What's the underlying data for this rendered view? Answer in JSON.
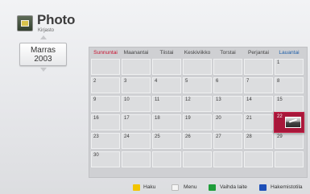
{
  "header": {
    "title": "Photo",
    "subtitle": "Kirjasto",
    "icon": "photo-icon"
  },
  "month_selector": {
    "month": "Marras",
    "year": "2003"
  },
  "calendar": {
    "day_headers": [
      "Sunnuntai",
      "Maanantai",
      "Tiistai",
      "Keskiviikko",
      "Torstai",
      "Perjantai",
      "Lauantai"
    ],
    "weeks": [
      [
        "",
        "",
        "",
        "",
        "",
        "",
        "1"
      ],
      [
        "2",
        "3",
        "4",
        "5",
        "6",
        "7",
        "8"
      ],
      [
        "9",
        "10",
        "11",
        "12",
        "13",
        "14",
        "15"
      ],
      [
        "16",
        "17",
        "18",
        "19",
        "20",
        "21",
        "22"
      ],
      [
        "23",
        "24",
        "25",
        "26",
        "27",
        "28",
        "29"
      ],
      [
        "30",
        "",
        "",
        "",
        "",
        "",
        ""
      ]
    ],
    "selected_day": "22",
    "colors": {
      "sunday": "#c8102e",
      "saturday": "#1f5fa8",
      "selected": "#a8173a"
    }
  },
  "footer": {
    "items": [
      {
        "color": "yellow",
        "key": "",
        "label": "Haku"
      },
      {
        "color": "white",
        "key": "",
        "label": "Menu"
      },
      {
        "color": "green",
        "key": "",
        "label": "Vaihda laite"
      },
      {
        "color": "blue",
        "key": "",
        "label": "Hakemistotila"
      }
    ]
  }
}
